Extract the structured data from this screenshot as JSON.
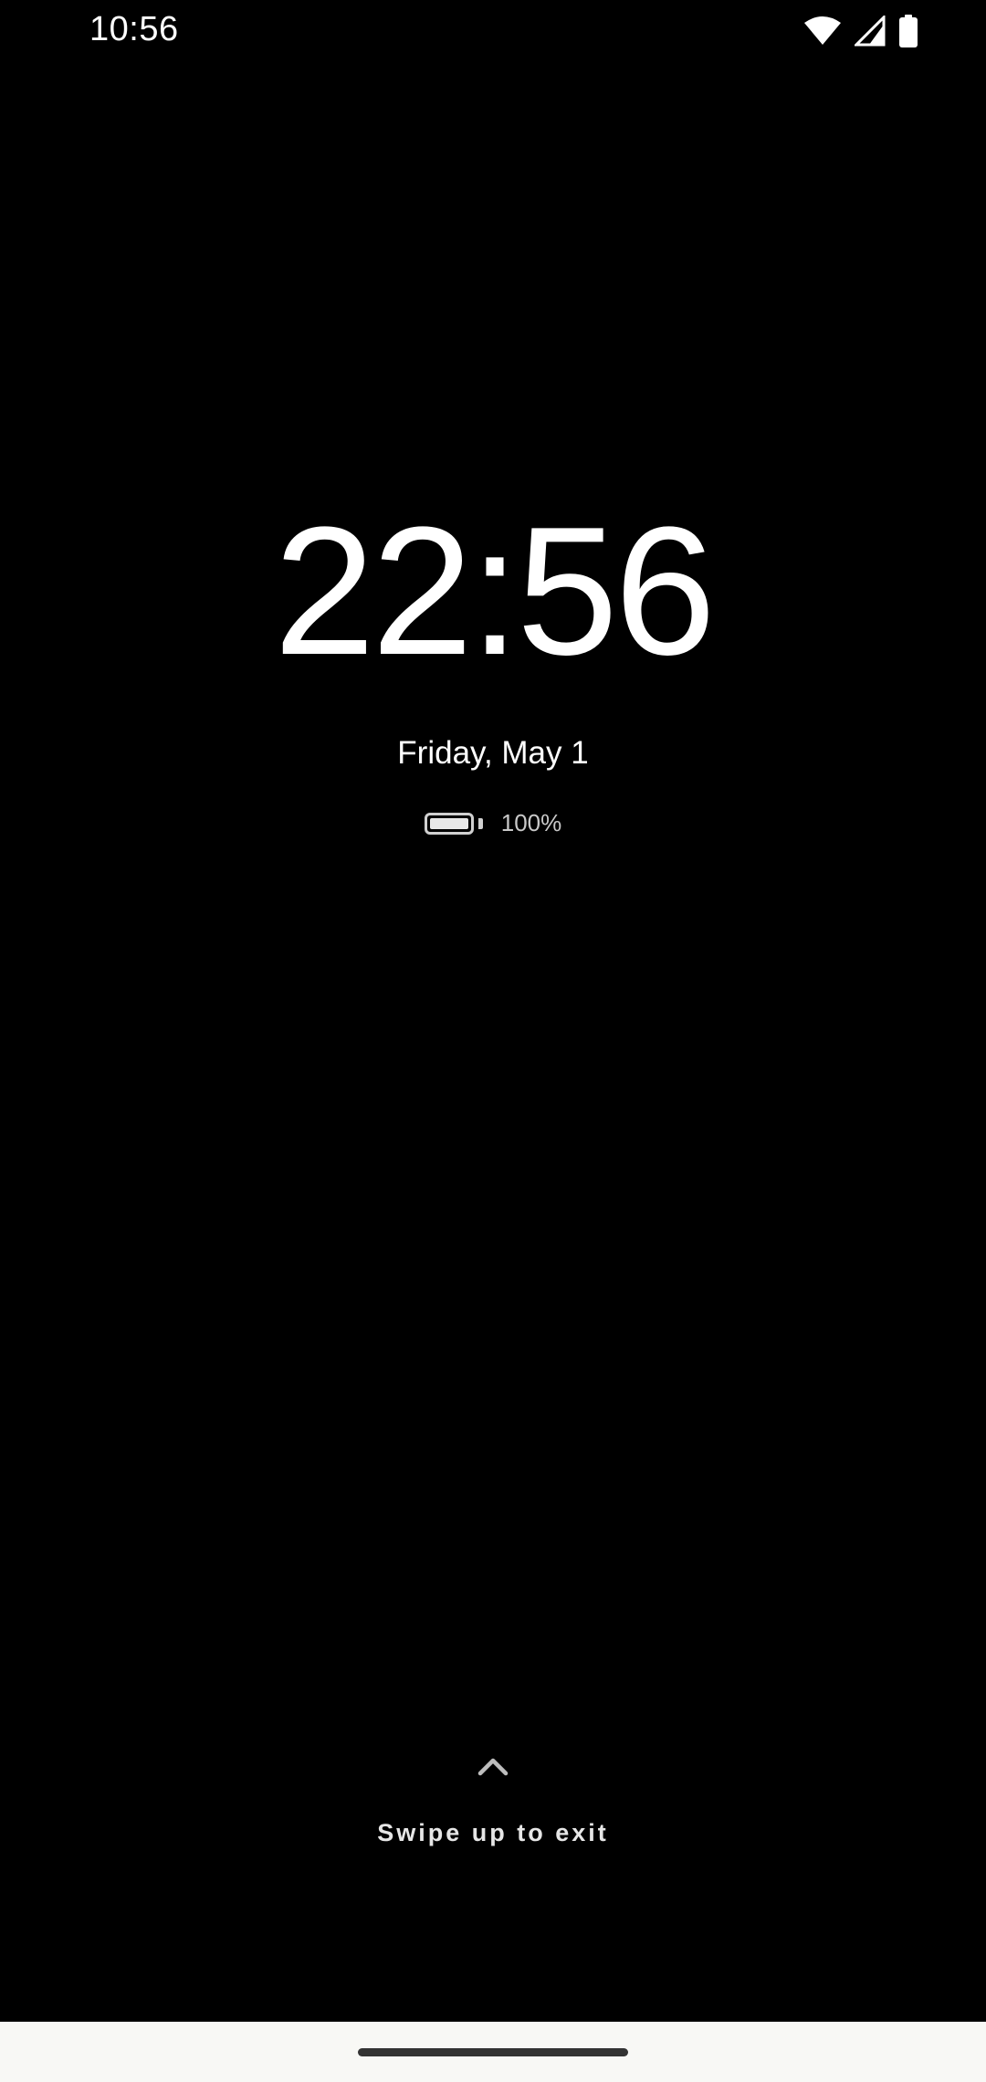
{
  "status_bar": {
    "time": "10:56",
    "icons": [
      "wifi-icon",
      "signal-icon",
      "battery-icon"
    ]
  },
  "screensaver": {
    "clock": "22:56",
    "date": "Friday, May 1",
    "battery": {
      "percent_text": "100%",
      "level": 1.0
    }
  },
  "swipe_hint": {
    "icon": "chevron-up-icon",
    "label": "Swipe up to exit"
  },
  "colors": {
    "background": "#000000",
    "text": "#ffffff",
    "nav_bar": "#f8f8f5"
  }
}
